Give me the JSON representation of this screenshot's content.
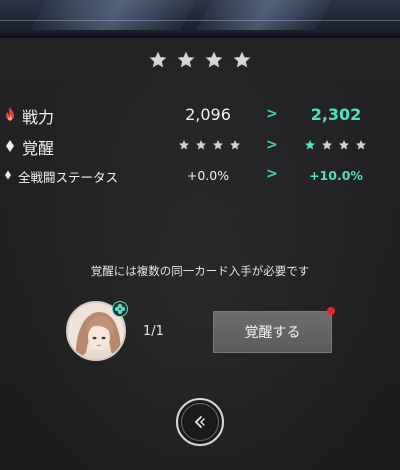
{
  "rarity": {
    "stars": 4,
    "icon": "star-icon"
  },
  "stats": [
    {
      "label": "戦力",
      "icon": "flame-icon",
      "current": "2,096",
      "arrow": ">",
      "next": "2,302"
    },
    {
      "label": "覚醒",
      "icon": "diamond-icon",
      "current_stars": 4,
      "next_stars": 4,
      "next_stars_highlighted": 1,
      "arrow": ">"
    },
    {
      "label": "全戦闘ステータス",
      "icon": "diamond-icon",
      "current": "+0.0%",
      "arrow": ">",
      "next": "+10.0%"
    }
  ],
  "notice": "覚醒には複数の同一カード入手が必要です",
  "card": {
    "icon": "character-avatar",
    "badge_icon": "clover-icon",
    "count": "1/1"
  },
  "awaken_button": {
    "label": "覚醒する",
    "badge": "red-dot"
  },
  "back_button": {
    "icon": "back-chevron-icon"
  },
  "colors": {
    "accent": "#4fe0c0",
    "background": "#1e1e20",
    "button": "#646466",
    "alert": "#e8262c"
  }
}
